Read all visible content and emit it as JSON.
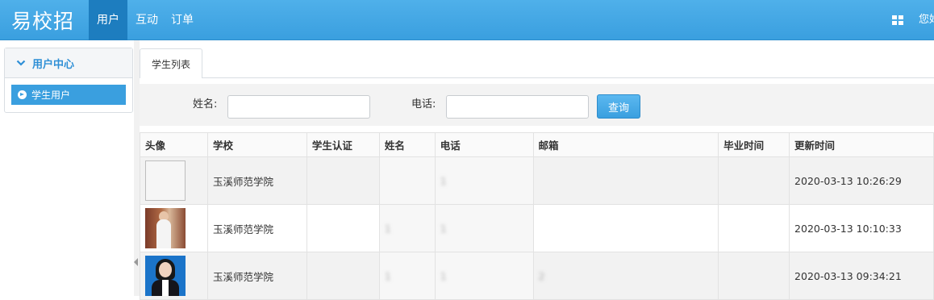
{
  "app": {
    "brand": "易校招"
  },
  "nav": {
    "items": [
      "用户",
      "互动",
      "订单"
    ],
    "active_index": 0,
    "greeting": "您好"
  },
  "sidebar": {
    "section_title": "用户中心",
    "items": [
      {
        "label": "学生用户",
        "active": true
      }
    ]
  },
  "tabs": [
    {
      "label": "学生列表",
      "active": true
    }
  ],
  "search": {
    "name_label": "姓名:",
    "name_value": "",
    "phone_label": "电话:",
    "phone_value": "",
    "submit_label": "查询"
  },
  "table": {
    "columns": [
      "头像",
      "学校",
      "学生认证",
      "姓名",
      "电话",
      "邮箱",
      "毕业时间",
      "更新时间"
    ],
    "rows": [
      {
        "avatar": "empty",
        "school": "玉溪师范学院",
        "verified": "",
        "name": "",
        "phone": "1",
        "email": "",
        "graduation": "",
        "updated": "2020-03-13 10:26:29"
      },
      {
        "avatar": "photo-1",
        "school": "玉溪师范学院",
        "verified": "",
        "name": "1",
        "phone": "1",
        "email": "",
        "graduation": "",
        "updated": "2020-03-13 10:10:33"
      },
      {
        "avatar": "photo-2",
        "school": "玉溪师范学院",
        "verified": "",
        "name": "1",
        "phone": "1",
        "email": "2",
        "graduation": "",
        "updated": "2020-03-13 09:34:21"
      }
    ]
  },
  "colors": {
    "accent": "#3a9fdf",
    "topbar": "#4fb0ea",
    "nav_active": "#1d7dbf"
  }
}
